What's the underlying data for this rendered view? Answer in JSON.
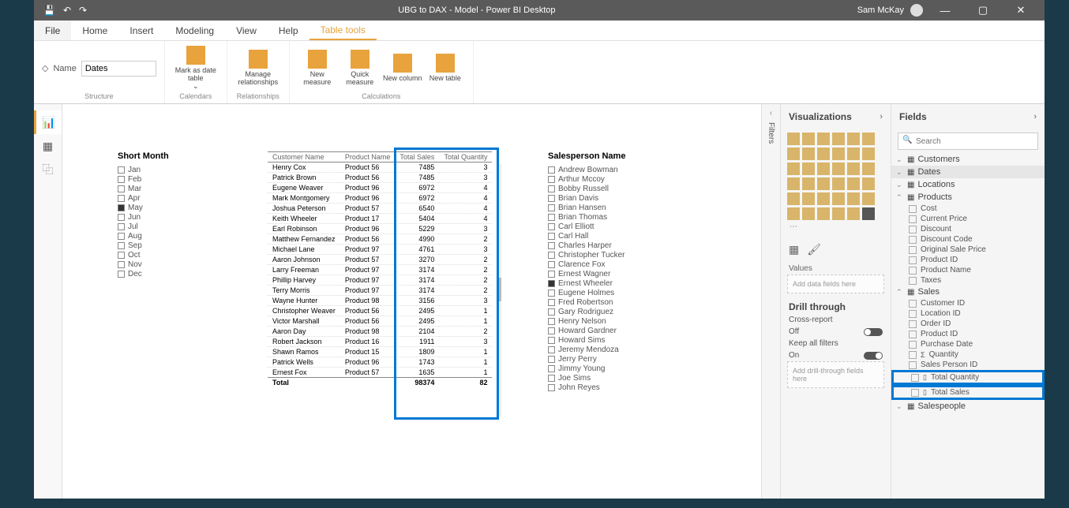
{
  "titlebar": {
    "title": "UBG to DAX - Model - Power BI Desktop",
    "user": "Sam McKay"
  },
  "ribbon": {
    "file": "File",
    "tabs": [
      "Home",
      "Insert",
      "Modeling",
      "View",
      "Help",
      "Table tools"
    ],
    "active_tab": "Table tools",
    "name_label": "Name",
    "name_value": "Dates",
    "groups": {
      "structure": "Structure",
      "calendars": "Calendars",
      "relationships": "Relationships",
      "calculations": "Calculations"
    },
    "buttons": {
      "mark_date": "Mark as date table",
      "manage_rel": "Manage relationships",
      "new_measure": "New measure",
      "quick_measure": "Quick measure",
      "new_column": "New column",
      "new_table": "New table"
    }
  },
  "filters": {
    "label": "Filters"
  },
  "visualizations": {
    "title": "Visualizations",
    "values_label": "Values",
    "values_placeholder": "Add data fields here",
    "drill_label": "Drill through",
    "cross_report": "Cross-report",
    "cross_value": "Off",
    "keep_filters": "Keep all filters",
    "keep_value": "On",
    "drill_placeholder": "Add drill-through fields here"
  },
  "fields": {
    "title": "Fields",
    "search_placeholder": "Search",
    "tables": [
      {
        "name": "Customers",
        "expanded": false
      },
      {
        "name": "Dates",
        "expanded": false,
        "selected": true
      },
      {
        "name": "Locations",
        "expanded": false
      },
      {
        "name": "Products",
        "expanded": true,
        "fields": [
          {
            "name": "Cost"
          },
          {
            "name": "Current Price"
          },
          {
            "name": "Discount"
          },
          {
            "name": "Discount Code"
          },
          {
            "name": "Original Sale Price"
          },
          {
            "name": "Product ID"
          },
          {
            "name": "Product Name"
          },
          {
            "name": "Taxes"
          }
        ]
      },
      {
        "name": "Sales",
        "expanded": true,
        "fields": [
          {
            "name": "Customer ID"
          },
          {
            "name": "Location ID"
          },
          {
            "name": "Order ID"
          },
          {
            "name": "Product ID"
          },
          {
            "name": "Purchase Date"
          },
          {
            "name": "Quantity",
            "sigma": true
          },
          {
            "name": "Sales Person ID"
          },
          {
            "name": "Total Quantity",
            "highlight": true,
            "calc": true
          },
          {
            "name": "Total Sales",
            "highlight": true,
            "calc": true
          }
        ]
      },
      {
        "name": "Salespeople",
        "expanded": false
      }
    ]
  },
  "slicer_month": {
    "title": "Short Month",
    "items": [
      "Jan",
      "Feb",
      "Mar",
      "Apr",
      "May",
      "Jun",
      "Jul",
      "Aug",
      "Sep",
      "Oct",
      "Nov",
      "Dec"
    ],
    "checked": [
      "May"
    ]
  },
  "slicer_sales": {
    "title": "Salesperson Name",
    "items": [
      "Andrew Bowman",
      "Arthur Mccoy",
      "Bobby Russell",
      "Brian Davis",
      "Brian Hansen",
      "Brian Thomas",
      "Carl Elliott",
      "Carl Hall",
      "Charles Harper",
      "Christopher Tucker",
      "Clarence Fox",
      "Ernest Wagner",
      "Ernest Wheeler",
      "Eugene Holmes",
      "Fred Robertson",
      "Gary Rodriguez",
      "Henry Nelson",
      "Howard Gardner",
      "Howard Sims",
      "Jeremy Mendoza",
      "Jerry Perry",
      "Jimmy Young",
      "Joe Sims",
      "John Reyes"
    ],
    "checked": [
      "Ernest Wheeler"
    ]
  },
  "table": {
    "headers": [
      "Customer Name",
      "Product Name",
      "Total Sales",
      "Total Quantity"
    ],
    "rows": [
      [
        "Henry Cox",
        "Product 56",
        "7485",
        "3"
      ],
      [
        "Patrick Brown",
        "Product 56",
        "7485",
        "3"
      ],
      [
        "Eugene Weaver",
        "Product 96",
        "6972",
        "4"
      ],
      [
        "Mark Montgomery",
        "Product 96",
        "6972",
        "4"
      ],
      [
        "Joshua Peterson",
        "Product 57",
        "6540",
        "4"
      ],
      [
        "Keith Wheeler",
        "Product 17",
        "5404",
        "4"
      ],
      [
        "Earl Robinson",
        "Product 96",
        "5229",
        "3"
      ],
      [
        "Matthew Fernandez",
        "Product 56",
        "4990",
        "2"
      ],
      [
        "Michael Lane",
        "Product 97",
        "4761",
        "3"
      ],
      [
        "Aaron Johnson",
        "Product 57",
        "3270",
        "2"
      ],
      [
        "Larry Freeman",
        "Product 97",
        "3174",
        "2"
      ],
      [
        "Phillip Harvey",
        "Product 97",
        "3174",
        "2"
      ],
      [
        "Terry Morris",
        "Product 97",
        "3174",
        "2"
      ],
      [
        "Wayne Hunter",
        "Product 98",
        "3156",
        "3"
      ],
      [
        "Christopher Weaver",
        "Product 56",
        "2495",
        "1"
      ],
      [
        "Victor Marshall",
        "Product 56",
        "2495",
        "1"
      ],
      [
        "Aaron Day",
        "Product 98",
        "2104",
        "2"
      ],
      [
        "Robert Jackson",
        "Product 16",
        "1911",
        "3"
      ],
      [
        "Shawn Ramos",
        "Product 15",
        "1809",
        "1"
      ],
      [
        "Patrick Wells",
        "Product 96",
        "1743",
        "1"
      ],
      [
        "Ernest Fox",
        "Product 57",
        "1635",
        "1"
      ]
    ],
    "total_label": "Total",
    "total_sales": "98374",
    "total_qty": "82"
  }
}
